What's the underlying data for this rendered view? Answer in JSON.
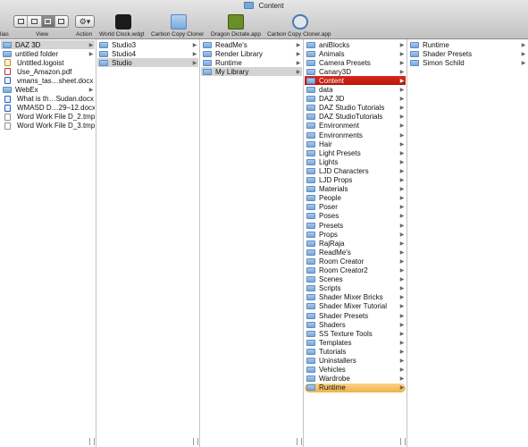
{
  "window": {
    "title": "Content"
  },
  "toolbar": {
    "view_label": "View",
    "action_label": "Action",
    "action_glyph": "⚙▾",
    "left_clip_label": "lias",
    "apps": [
      {
        "label": "World Clock.wdgt",
        "icon": "widget-icon"
      },
      {
        "label": "Carbon Copy Cloner",
        "icon": "folder-icon"
      },
      {
        "label": "Dragon Dictate.app",
        "icon": "dragon-icon"
      },
      {
        "label": "Carbon Copy Cloner.app",
        "icon": "ccc-icon"
      }
    ]
  },
  "colors": {
    "selection": "#c41e12",
    "path_highlight": "#d4d4d4",
    "orange_label": "#f2bd5a",
    "folder_blue": "#78a6da"
  },
  "columns": [
    {
      "items": [
        {
          "name": "DAZ 3D",
          "type": "folder",
          "arrow": "▶",
          "state": "path"
        },
        {
          "name": "untitled folder",
          "type": "folder",
          "arrow": "▶"
        },
        {
          "name": "Untitled.logoist",
          "type": "logo"
        },
        {
          "name": "Use_Amazon.pdf",
          "type": "pdf"
        },
        {
          "name": "vmans_tas…sheet.docx",
          "type": "doc"
        },
        {
          "name": "WebEx",
          "type": "folder",
          "arrow": "▶"
        },
        {
          "name": "What is th…Sudan.docx",
          "type": "doc"
        },
        {
          "name": "WMASD D…29–12.docx",
          "type": "doc"
        },
        {
          "name": "Word Work File D_2.tmp",
          "type": "file"
        },
        {
          "name": "Word Work File D_3.tmp",
          "type": "file"
        }
      ]
    },
    {
      "items": [
        {
          "name": "Studio3",
          "type": "folder",
          "arrow": "▶"
        },
        {
          "name": "Studio4",
          "type": "folder",
          "arrow": "▶"
        },
        {
          "name": "Studio",
          "type": "folder",
          "arrow": "▶",
          "state": "path"
        }
      ]
    },
    {
      "items": [
        {
          "name": "ReadMe's",
          "type": "folder",
          "arrow": "▶"
        },
        {
          "name": "Render Library",
          "type": "folder",
          "arrow": "▶"
        },
        {
          "name": "Runtime",
          "type": "folder",
          "arrow": "▶"
        },
        {
          "name": "My Library",
          "type": "folder",
          "arrow": "▶",
          "state": "path"
        }
      ]
    },
    {
      "items": [
        {
          "name": "aniBlocks",
          "type": "folder",
          "arrow": "▶"
        },
        {
          "name": "Animals",
          "type": "folder",
          "arrow": "▶"
        },
        {
          "name": "Camera Presets",
          "type": "folder",
          "arrow": "▶"
        },
        {
          "name": "Canary3D",
          "type": "folder",
          "arrow": "▶"
        },
        {
          "name": "Content",
          "type": "folder",
          "arrow": "▶",
          "state": "selected"
        },
        {
          "name": "data",
          "type": "folder",
          "arrow": "▶"
        },
        {
          "name": "DAZ 3D",
          "type": "folder",
          "arrow": "▶"
        },
        {
          "name": "DAZ Studio Tutorials",
          "type": "folder",
          "arrow": "▶"
        },
        {
          "name": "DAZ StudioTutorials",
          "type": "folder",
          "arrow": "▶"
        },
        {
          "name": "Environment",
          "type": "folder",
          "arrow": "▶"
        },
        {
          "name": "Environments",
          "type": "folder",
          "arrow": "▶"
        },
        {
          "name": "Hair",
          "type": "folder",
          "arrow": "▶"
        },
        {
          "name": "Light Presets",
          "type": "folder",
          "arrow": "▶"
        },
        {
          "name": "Lights",
          "type": "folder",
          "arrow": "▶"
        },
        {
          "name": "LJD Characters",
          "type": "folder",
          "arrow": "▶"
        },
        {
          "name": "LJD Props",
          "type": "folder",
          "arrow": "▶"
        },
        {
          "name": "Materials",
          "type": "folder",
          "arrow": "▶"
        },
        {
          "name": "People",
          "type": "folder",
          "arrow": "▶"
        },
        {
          "name": "Poser",
          "type": "folder",
          "arrow": "▶"
        },
        {
          "name": "Poses",
          "type": "folder",
          "arrow": "▶"
        },
        {
          "name": "Presets",
          "type": "folder",
          "arrow": "▶"
        },
        {
          "name": "Props",
          "type": "folder",
          "arrow": "▶"
        },
        {
          "name": "RajRaja",
          "type": "folder",
          "arrow": "▶"
        },
        {
          "name": "ReadMe's",
          "type": "folder",
          "arrow": "▶"
        },
        {
          "name": "Room Creator",
          "type": "folder",
          "arrow": "▶"
        },
        {
          "name": "Room Creator2",
          "type": "folder",
          "arrow": "▶"
        },
        {
          "name": "Scenes",
          "type": "folder",
          "arrow": "▶"
        },
        {
          "name": "Scripts",
          "type": "folder",
          "arrow": "▶"
        },
        {
          "name": "Shader Mixer Bricks",
          "type": "folder",
          "arrow": "▶"
        },
        {
          "name": "Shader Mixer Tutorial",
          "type": "folder",
          "arrow": "▶"
        },
        {
          "name": "Shader Presets",
          "type": "folder",
          "arrow": "▶"
        },
        {
          "name": "Shaders",
          "type": "folder",
          "arrow": "▶"
        },
        {
          "name": "SS Texture Tools",
          "type": "folder",
          "arrow": "▶"
        },
        {
          "name": "Templates",
          "type": "folder",
          "arrow": "▶"
        },
        {
          "name": "Tutorials",
          "type": "folder",
          "arrow": "▶"
        },
        {
          "name": "Uninstallers",
          "type": "folder",
          "arrow": "▶"
        },
        {
          "name": "Vehicles",
          "type": "folder",
          "arrow": "▶"
        },
        {
          "name": "Wardrobe",
          "type": "folder",
          "arrow": "▶"
        },
        {
          "name": "Runtime",
          "type": "folder",
          "arrow": "▶",
          "state": "label-orange"
        }
      ]
    },
    {
      "items": [
        {
          "name": "Runtime",
          "type": "folder",
          "arrow": "▶"
        },
        {
          "name": "Shader Presets",
          "type": "folder",
          "arrow": "▶"
        },
        {
          "name": "Simon Schild",
          "type": "folder",
          "arrow": "▶"
        }
      ]
    }
  ]
}
